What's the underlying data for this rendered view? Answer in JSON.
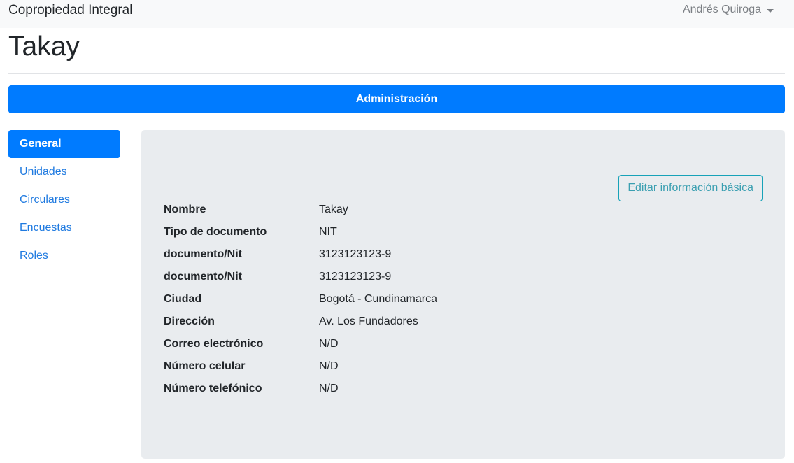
{
  "navbar": {
    "brand": "Copropiedad Integral",
    "user_name": "Andrés Quiroga"
  },
  "page": {
    "title": "Takay"
  },
  "admin_bar": {
    "label": "Administración"
  },
  "sidebar": {
    "items": [
      {
        "label": "General",
        "active": true
      },
      {
        "label": "Unidades",
        "active": false
      },
      {
        "label": "Circulares",
        "active": false
      },
      {
        "label": "Encuestas",
        "active": false
      },
      {
        "label": "Roles",
        "active": false
      }
    ]
  },
  "panel": {
    "edit_button": "Editar información básica",
    "rows": [
      {
        "label": "Nombre",
        "value": "Takay"
      },
      {
        "label": "Tipo de documento",
        "value": "NIT"
      },
      {
        "label": "documento/Nit",
        "value": "3123123123-9"
      },
      {
        "label": "documento/Nit",
        "value": "3123123123-9"
      },
      {
        "label": "Ciudad",
        "value": "Bogotá - Cundinamarca"
      },
      {
        "label": "Dirección",
        "value": "Av. Los Fundadores"
      },
      {
        "label": "Correo electrónico",
        "value": "N/D"
      },
      {
        "label": "Número celular",
        "value": "N/D"
      },
      {
        "label": "Número telefónico",
        "value": "N/D"
      }
    ]
  },
  "colors": {
    "primary": "#007bff",
    "info_outline": "#17a2b8",
    "panel_bg": "#e9ecef",
    "navbar_bg": "#f8f9fa"
  }
}
